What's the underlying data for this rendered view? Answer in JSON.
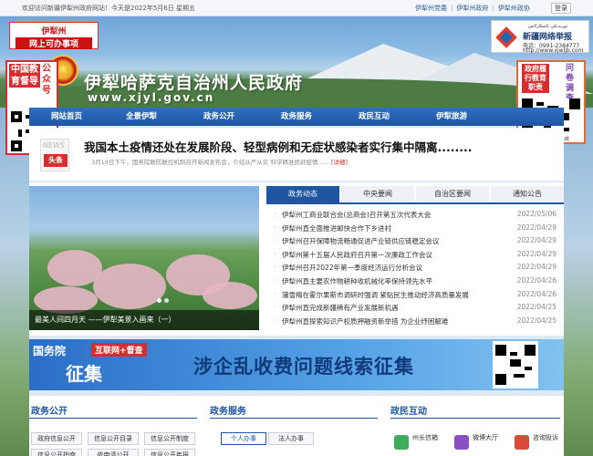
{
  "topbar": {
    "welcome": "欢迎访问新疆伊犁州政府网站！今天是2022年5月6日 星期五",
    "links": [
      "伊犁州党委",
      "伊犁州政府",
      "伊犁州政协"
    ],
    "login": "登录"
  },
  "header": {
    "title": "伊犁哈萨克自治州人民政府",
    "url": "www.xjyl.gov.cn"
  },
  "left_float": {
    "top_line1": "伊犁州",
    "top_line2": "网上可办事项",
    "panel_left": "中国教育督导",
    "panel_right": "公众号"
  },
  "report_box": {
    "uyghur": "تورىدىكى ئاشكارلاش",
    "title": "新疆网络举报",
    "phone": "电话：0991-2384777",
    "web": "http://www.xjwljb.com"
  },
  "right_float": {
    "left": "政府履行教育职责",
    "right": "问卷调查",
    "footer": "扫码进入问卷系统"
  },
  "nav": {
    "items": [
      "网站首页",
      "全景伊犁",
      "政务公开",
      "政务服务",
      "政民互动",
      "伊犁旅游"
    ]
  },
  "headline": {
    "badge_top": "NEWS",
    "badge": "头条",
    "title": "我国本土疫情还处在发展阶段、轻型病例和无症状感染者实行集中隔离........",
    "summary": "3月19日下午，国务院联防联控机制召开新闻发布会，介绍从严从实 科学精准抓好疫情......",
    "more": "[详细]"
  },
  "slider": {
    "caption": "最美人间四月天 ——伊犁美景入画来（一）"
  },
  "tabs": [
    "政务动态",
    "中央要闻",
    "自治区要闻",
    "通知公告"
  ],
  "news": [
    {
      "title": "伊犁州工商业联合会(总商会)召开第五次代表大会",
      "date": "2022/05/06"
    },
    {
      "title": "伊犁州直全面推进邮快合作下乡进村",
      "date": "2022/04/29"
    },
    {
      "title": "伊犁州召开保障物流畅通促进产业链供应链稳定会议",
      "date": "2022/04/29"
    },
    {
      "title": "伊犁州第十五届人民政府召开第一次廉政工作会议",
      "date": "2022/04/29"
    },
    {
      "title": "伊犁州召开2022年第一季度经济运行分析会议",
      "date": "2022/04/29"
    },
    {
      "title": "伊犁州直主要农作物耕种收机械化率保持领先水平",
      "date": "2022/04/26"
    },
    {
      "title": "蒲雪梅在霍尔果斯市调研时强调 紧贴民生推动经济高质量发展",
      "date": "2022/04/26"
    },
    {
      "title": "伊犁州直完成新疆稀有产业发展新机遇",
      "date": "2022/04/25"
    },
    {
      "title": "伊犁州直探索知识产权质押融资新举措 为企业纾困解难",
      "date": "2022/04/25"
    }
  ],
  "banner": {
    "gwy": "国务院",
    "tag": "互联网+督查",
    "zj": "征集",
    "main": "涉企乱收费问题线索征集"
  },
  "bottom": {
    "sec1": {
      "title": "政务公开",
      "pills": [
        "政府信息公开",
        "信息公开目录",
        "信息公开制度",
        "信息公开指南",
        "依申请公开",
        "信息公开年报"
      ]
    },
    "sec2": {
      "title": "政务服务",
      "tabs": [
        "个人办事",
        "法人办事"
      ]
    },
    "sec3": {
      "title": "政民互动",
      "tiles": [
        {
          "label": "州长信箱",
          "color": "#3fae5a"
        },
        {
          "label": "微博大厅",
          "color": "#8a4fc6"
        },
        {
          "label": "咨询投诉",
          "color": "#d94a3a"
        }
      ]
    }
  }
}
